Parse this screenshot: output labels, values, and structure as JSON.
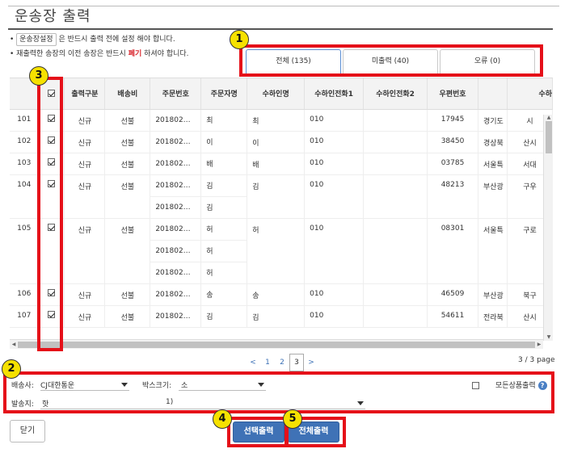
{
  "page": {
    "title": "운송장 출력"
  },
  "notes": {
    "line1_box": "운송장설정",
    "line1_text": "은 반드시 출력 전에 설정 해야 합니다.",
    "line2_pre": "재출력한 송장의 이전 송장은 반드시",
    "line2_red": "폐기",
    "line2_post": "하셔야 합니다."
  },
  "tabs": [
    {
      "label": "전체 (135)"
    },
    {
      "label": "미출력 (40)"
    },
    {
      "label": "오류 (0)"
    }
  ],
  "markers": [
    "1",
    "2",
    "3",
    "4",
    "5"
  ],
  "grid": {
    "headers": [
      "",
      "출력구분",
      "배송비",
      "주문번호",
      "주문자명",
      "수하인명",
      "수하인전화1",
      "수하인전화2",
      "우편번호",
      "수하"
    ],
    "rows": [
      {
        "no": "101",
        "checked": true,
        "type": "신규",
        "fee": "선불",
        "orders": [
          {
            "order": "201802…",
            "name": "최"
          }
        ],
        "recv": "최",
        "tel1": "010",
        "tel2": "",
        "zip": "17945",
        "addr": "경기도",
        "more": "시"
      },
      {
        "no": "102",
        "checked": true,
        "type": "신규",
        "fee": "선불",
        "orders": [
          {
            "order": "201802…",
            "name": "이"
          }
        ],
        "recv": "이",
        "tel1": "010",
        "tel2": "",
        "zip": "38450",
        "addr": "경상북",
        "more": "산시"
      },
      {
        "no": "103",
        "checked": true,
        "type": "신규",
        "fee": "선불",
        "orders": [
          {
            "order": "201802…",
            "name": "배"
          }
        ],
        "recv": "배",
        "tel1": "010",
        "tel2": "",
        "zip": "03785",
        "addr": "서울특",
        "more": "서대"
      },
      {
        "no": "104",
        "checked": true,
        "type": "신규",
        "fee": "선불",
        "orders": [
          {
            "order": "201802…",
            "name": "김"
          },
          {
            "order": "201802…",
            "name": "김"
          }
        ],
        "recv": "김",
        "tel1": "010",
        "tel2": "",
        "zip": "48213",
        "addr": "부산광",
        "more": "구우"
      },
      {
        "no": "105",
        "checked": true,
        "type": "신규",
        "fee": "선불",
        "orders": [
          {
            "order": "201802…",
            "name": "허"
          },
          {
            "order": "201802…",
            "name": "허"
          },
          {
            "order": "201802…",
            "name": "허"
          }
        ],
        "recv": "허",
        "tel1": "010",
        "tel2": "",
        "zip": "08301",
        "addr": "서울특",
        "more": "구로"
      },
      {
        "no": "106",
        "checked": true,
        "type": "신규",
        "fee": "선불",
        "orders": [
          {
            "order": "201802…",
            "name": "송"
          }
        ],
        "recv": "송",
        "tel1": "010",
        "tel2": "",
        "zip": "46509",
        "addr": "부산광",
        "more": "북구"
      },
      {
        "no": "107",
        "checked": true,
        "type": "신규",
        "fee": "선불",
        "orders": [
          {
            "order": "201802…",
            "name": "김"
          }
        ],
        "recv": "김",
        "tel1": "010",
        "tel2": "",
        "zip": "54611",
        "addr": "전라북",
        "more": "산시"
      }
    ]
  },
  "pager": {
    "prev": "<",
    "pages": [
      "1",
      "2",
      "3"
    ],
    "current": "3",
    "next": ">",
    "info": "3 / 3 page"
  },
  "options": {
    "carrier_label": "배송사:",
    "carrier_value": "CJ대한통운",
    "boxsize_label": "박스크기:",
    "boxsize_value": "소",
    "all_products_label": "모든상품출력",
    "help_glyph": "?",
    "sender_label": "발송지:",
    "sender_value": "핫",
    "sender_value_tail": "1)"
  },
  "buttons": {
    "close": "닫기",
    "print_selected": "선택출력",
    "print_all": "전체출력"
  },
  "colors": {
    "highlight_red": "#e51019",
    "marker_yellow": "#f6e100",
    "primary_blue": "#3f72b6"
  }
}
